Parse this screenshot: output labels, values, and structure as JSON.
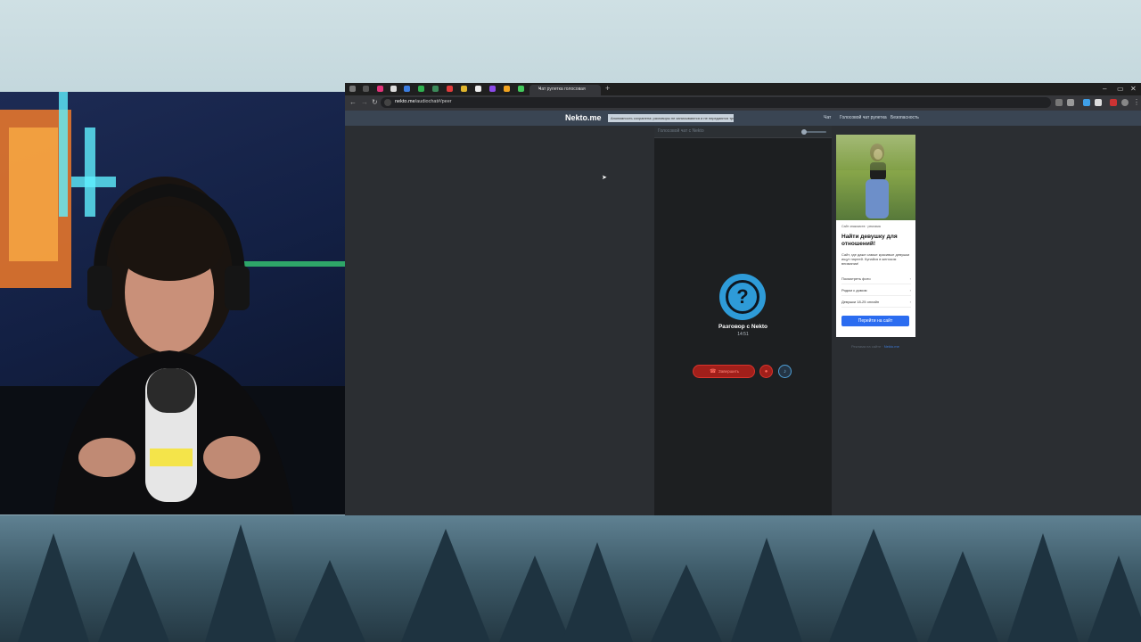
{
  "browser": {
    "active_tab_title": "Чат рулетка голосовая",
    "url_host": "nekto.me",
    "url_path": "/audiochat#/peer",
    "new_tab_glyph": "+",
    "window_controls": [
      "–",
      "▭",
      "✕"
    ]
  },
  "site": {
    "logo": "Nekto.me",
    "notice": "Анонимность сохранена: разговоры не записываются и не передаются третьим лицам",
    "nav": [
      "Чат",
      "Голосовой чат рулетка",
      "Безопасность"
    ]
  },
  "chat": {
    "header_title": "Голосовой чат с Nekto",
    "avatar_glyph": "?",
    "conversation_title": "Разговор с Nekto",
    "timer": "14:51",
    "end_button_label": "Завершить",
    "mic_mute_icon": "mic-off-icon",
    "mic_icon": "mic-icon"
  },
  "ad": {
    "source": "Сайт знакомств · реклама",
    "title": "Найти девушку для отношений!",
    "description": "Сайт, где даже самые красивые девушки ищут парней. Купайся в женском внимании!",
    "links": [
      "Посмотреть фото",
      "Рядом с домом",
      "Девушки 18-25 онлайн"
    ],
    "cta": "Перейти на сайт",
    "footer_text": "Реклама на сайте ·",
    "footer_link": "Nekto.me"
  },
  "colors": {
    "accent_blue": "#2e9bd8",
    "end_call_red": "#a11f1a",
    "ad_cta": "#2b6cf0",
    "site_nav": "#3a4553"
  }
}
